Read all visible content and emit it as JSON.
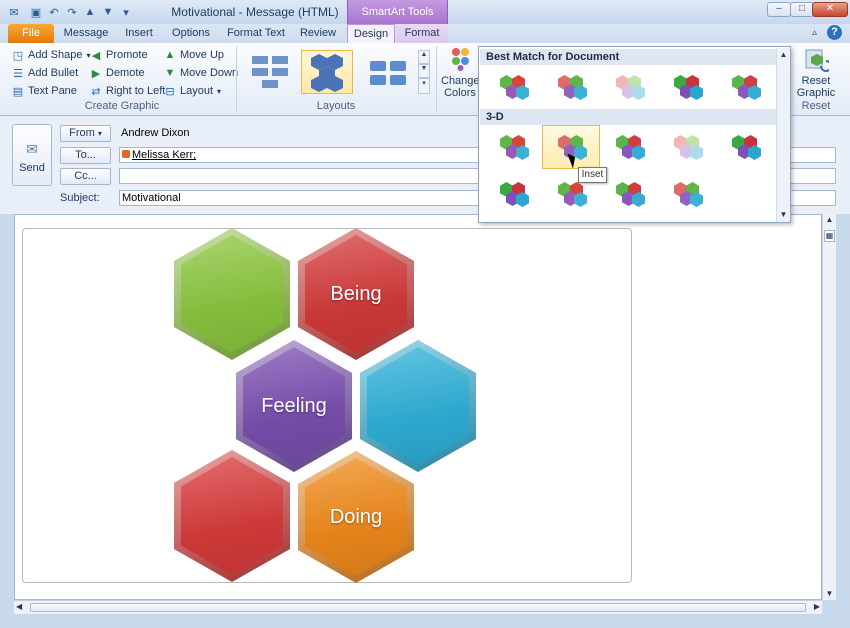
{
  "window": {
    "title": "Motivational  -  Message (HTML)",
    "context_tab_group": "SmartArt Tools",
    "minimize": "–",
    "maximize": "□",
    "close": "✕"
  },
  "tabs": [
    "File",
    "Message",
    "Insert",
    "Options",
    "Format Text",
    "Review",
    "Design",
    "Format"
  ],
  "ribbon": {
    "create_graphic": {
      "label": "Create Graphic",
      "add_shape": "Add Shape",
      "add_bullet": "Add Bullet",
      "text_pane": "Text Pane",
      "promote": "Promote",
      "demote": "Demote",
      "right_to_left": "Right to Left",
      "move_up": "Move Up",
      "move_down": "Move Down",
      "layout": "Layout"
    },
    "layouts": {
      "label": "Layouts"
    },
    "change_colors": {
      "line1": "Change",
      "line2": "Colors"
    },
    "reset": {
      "label": "Reset",
      "line1": "Reset",
      "line2": "Graphic"
    }
  },
  "message": {
    "send": "Send",
    "from_label": "From",
    "from_value": "Andrew Dixon",
    "to_label": "To...",
    "to_value": "Melissa Kerr;",
    "cc_label": "Cc...",
    "subject_label": "Subject:",
    "subject_value": "Motivational"
  },
  "smartart": {
    "hexagons": [
      {
        "label": "",
        "color": "#8cc63f"
      },
      {
        "label": "Being",
        "color": "#d43a3a"
      },
      {
        "label": "Feeling",
        "color": "#7a4fb0"
      },
      {
        "label": "",
        "color": "#2fb0d8"
      },
      {
        "label": "",
        "color": "#d83b3b"
      },
      {
        "label": "Doing",
        "color": "#f08a1c"
      }
    ]
  },
  "gallery": {
    "section1": "Best Match for Document",
    "section2": "3-D",
    "tooltip": "Inset"
  }
}
